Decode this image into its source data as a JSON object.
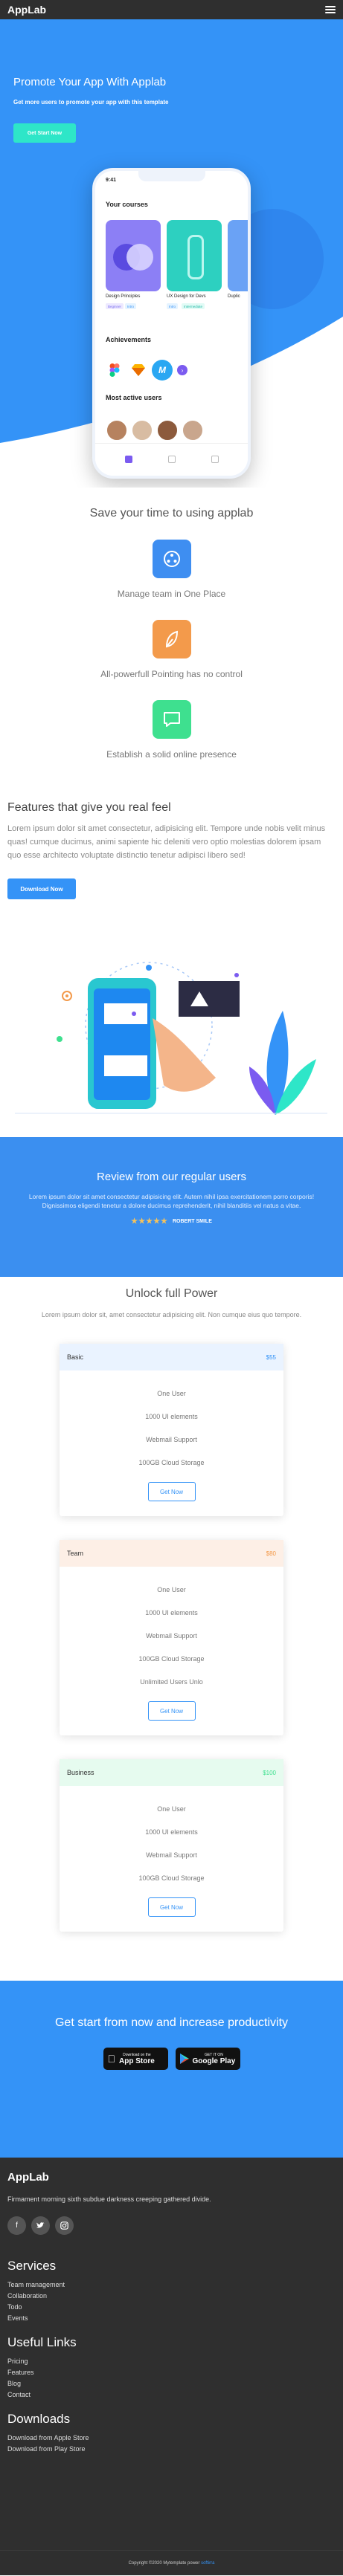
{
  "app": {
    "logo": "AppLab"
  },
  "hero": {
    "title": "Promote Your App With Applab",
    "subtitle": "Get more users to promote your app with this template",
    "cta": "Get Start Now"
  },
  "phone": {
    "time": "9:41",
    "courses_title": "Your courses",
    "courses": [
      {
        "title": "Design Principles",
        "tag1": "Beginner",
        "tag2": "Intro"
      },
      {
        "title": "UX Design for Devs",
        "tag1": "Intro",
        "tag2": "Intermediate"
      },
      {
        "title": "Duplic"
      }
    ],
    "achievements_title": "Achievements",
    "users_title": "Most active users"
  },
  "features": {
    "title": "Save your time to using applab",
    "items": [
      {
        "label": "Manage team in One Place",
        "color": "#3e8ef1",
        "icon": "team-icon"
      },
      {
        "label": "All-powerfull Pointing has no control",
        "color": "#f39a4b",
        "icon": "leaf-icon"
      },
      {
        "label": "Establish a solid online presence",
        "color": "#3ee08f",
        "icon": "chat-icon"
      }
    ]
  },
  "feel": {
    "title": "Features that give you real feel",
    "body": "Lorem ipsum dolor sit amet consectetur, adipisicing elit. Tempore unde nobis velit minus quas! cumque ducimus, animi sapiente hic deleniti vero optio molestias dolorem ipsam quo esse architecto voluptate distinctio tenetur adipisci libero sed!",
    "button": "Download Now"
  },
  "review": {
    "title": "Review from our regular users",
    "body": "Lorem ipsum dolor sit amet consectetur adipisicing elit. Autem nihil ipsa exercitationem porro corporis! Dignissimos eligendi tenetur a dolore ducimus reprehenderit, nihil blanditiis vel natus a vitae.",
    "reviewer": "ROBERT SMILE",
    "rating": 5
  },
  "pricing": {
    "title": "Unlock full Power",
    "lead": "Lorem ipsum dolor sit, amet consectetur adipisicing elit. Non cumque eius quo tempore.",
    "plans": [
      {
        "name": "Basic",
        "price": "$55",
        "color": "#eaf3ff",
        "price_color": "#3493f7",
        "features": [
          "One User",
          "1000 UI elements",
          "Webmail Support",
          "100GB Cloud Storage"
        ],
        "button": "Get Now"
      },
      {
        "name": "Team",
        "price": "$80",
        "color": "#fdefe6",
        "price_color": "#f39a4b",
        "features": [
          "One User",
          "1000 UI elements",
          "Webmail Support",
          "100GB Cloud Storage",
          "Unlimited Users Unlo"
        ],
        "button": "Get Now"
      },
      {
        "name": "Business",
        "price": "$100",
        "color": "#e6fbef",
        "price_color": "#3ee08f",
        "features": [
          "One User",
          "1000 UI elements",
          "Webmail Support",
          "100GB Cloud Storage"
        ],
        "button": "Get Now"
      }
    ]
  },
  "getstart": {
    "title": "Get start from now and increase productivity",
    "appstore_small": "Download on the",
    "appstore_big": "App Store",
    "play_small": "GET IT ON",
    "play_big": "Google Play"
  },
  "footer": {
    "logo": "AppLab",
    "tagline": "Firmament morning sixth subdue darkness creeping gathered divide.",
    "services_title": "Services",
    "services": [
      "Team management",
      "Collaboration",
      "Todo",
      "Events"
    ],
    "useful_title": "Useful Links",
    "useful": [
      "Pricing",
      "Features",
      "Blog",
      "Contact"
    ],
    "downloads_title": "Downloads",
    "downloads": [
      "Download from Apple Store",
      "Download from Play Store"
    ],
    "copyright": "Copyright ©2020 Mytemplate power",
    "copyright_by": "softirra"
  }
}
